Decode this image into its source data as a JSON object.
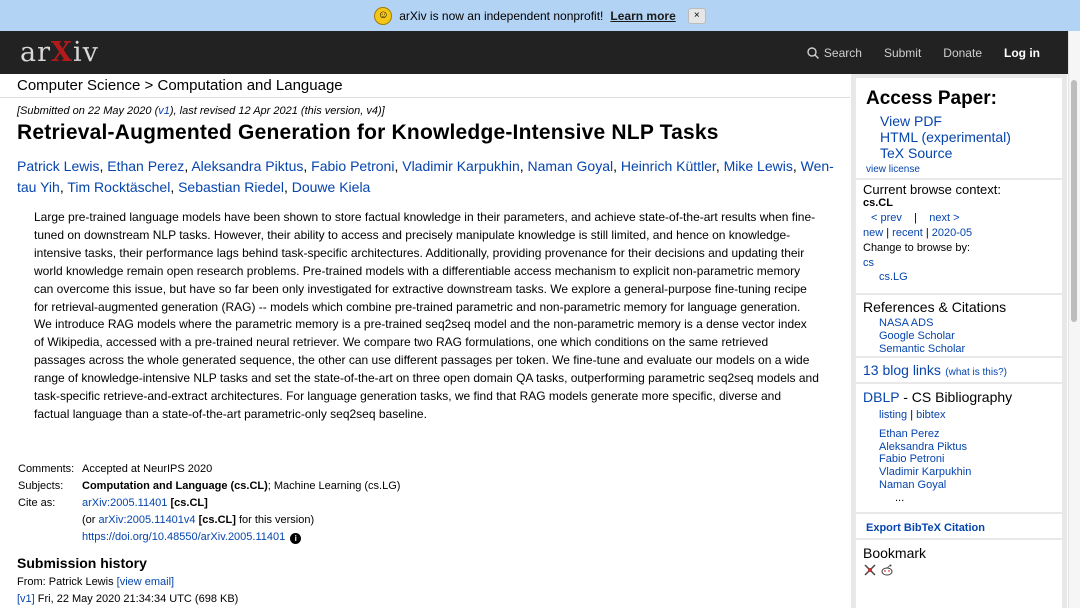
{
  "announcement": {
    "text": "arXiv is now an independent nonprofit!",
    "link": "Learn more",
    "close": "×"
  },
  "header": {
    "logo_left": "ar",
    "logo_x": "X",
    "logo_right": "iv",
    "nav": {
      "search": "Search",
      "submit": "Submit",
      "donate": "Donate",
      "login": "Log in"
    }
  },
  "breadcrumb": "Computer Science > Computation and Language",
  "submitted": {
    "prefix": "[Submitted on 22 May 2020 (",
    "v1": "v1",
    "suffix": "), last revised 12 Apr 2021 (this version, v4)]"
  },
  "title": "Retrieval-Augmented Generation for Knowledge-Intensive NLP Tasks",
  "authors": [
    "Patrick Lewis",
    "Ethan Perez",
    "Aleksandra Piktus",
    "Fabio Petroni",
    "Vladimir Karpukhin",
    "Naman Goyal",
    "Heinrich Küttler",
    "Mike Lewis",
    "Wen-tau Yih",
    "Tim Rocktäschel",
    "Sebastian Riedel",
    "Douwe Kiela"
  ],
  "abstract": "Large pre-trained language models have been shown to store factual knowledge in their parameters, and achieve state-of-the-art results when fine-tuned on downstream NLP tasks. However, their ability to access and precisely manipulate knowledge is still limited, and hence on knowledge-intensive tasks, their performance lags behind task-specific architectures. Additionally, providing provenance for their decisions and updating their world knowledge remain open research problems. Pre-trained models with a differentiable access mechanism to explicit non-parametric memory can overcome this issue, but have so far been only investigated for extractive downstream tasks. We explore a general-purpose fine-tuning recipe for retrieval-augmented generation (RAG) -- models which combine pre-trained parametric and non-parametric memory for language generation. We introduce RAG models where the parametric memory is a pre-trained seq2seq model and the non-parametric memory is a dense vector index of Wikipedia, accessed with a pre-trained neural retriever. We compare two RAG formulations, one which conditions on the same retrieved passages across the whole generated sequence, the other can use different passages per token. We fine-tune and evaluate our models on a wide range of knowledge-intensive NLP tasks and set the state-of-the-art on three open domain QA tasks, outperforming parametric seq2seq models and task-specific retrieve-and-extract architectures. For language generation tasks, we find that RAG models generate more specific, diverse and factual language than a state-of-the-art parametric-only seq2seq baseline.",
  "meta": {
    "comments_label": "Comments:",
    "comments": "Accepted at NeurIPS 2020",
    "subjects_label": "Subjects:",
    "subjects_primary": "Computation and Language (cs.CL)",
    "subjects_rest": "; Machine Learning (cs.LG)",
    "cite_label": "Cite as:",
    "cite_id": "arXiv:2005.11401",
    "cite_cat": "[cs.CL]",
    "cite_or": "(or ",
    "cite_version_id": "arXiv:2005.11401v4",
    "cite_version_cat": "[cs.CL]",
    "cite_version_suffix": " for this version)",
    "doi": "https://doi.org/10.48550/arXiv.2005.11401",
    "info_glyph": "i"
  },
  "history": {
    "heading": "Submission history",
    "from_prefix": "From: Patrick Lewis ",
    "view_email": "[view email]",
    "v1_link": "[v1]",
    "v1_text": " Fri, 22 May 2020 21:34:34 UTC (698 KB)"
  },
  "sidebar": {
    "access": {
      "heading": "Access Paper:",
      "links": [
        "View PDF",
        "HTML (experimental)",
        "TeX Source"
      ],
      "license": "view license"
    },
    "browse": {
      "heading": "Current browse context:",
      "context": "cs.CL",
      "prev": "< prev",
      "sep": "|",
      "next": "next >",
      "new": "new",
      "recent": "recent",
      "date": "2020-05",
      "change": "Change to browse by:",
      "cats": [
        "cs",
        "cs.LG"
      ]
    },
    "refs": {
      "heading": "References & Citations",
      "links": [
        "NASA ADS",
        "Google Scholar",
        "Semantic Scholar"
      ]
    },
    "blog": {
      "count_text": "13 blog links",
      "what": "(what is this?)"
    },
    "dblp": {
      "heading": "DBLP",
      "heading_rest": " - CS Bibliography",
      "listing": "listing",
      "bibtex": "bibtex",
      "authors": [
        "Ethan Perez",
        "Aleksandra Piktus",
        "Fabio Petroni",
        "Vladimir Karpukhin",
        "Naman Goyal"
      ],
      "more": "..."
    },
    "export": "Export BibTeX Citation",
    "bookmark": {
      "heading": "Bookmark"
    }
  },
  "colors": {
    "link": "#0645ad",
    "header": "#222222",
    "announce": "#b3d3f4",
    "brand_red": "#b31b1b"
  }
}
